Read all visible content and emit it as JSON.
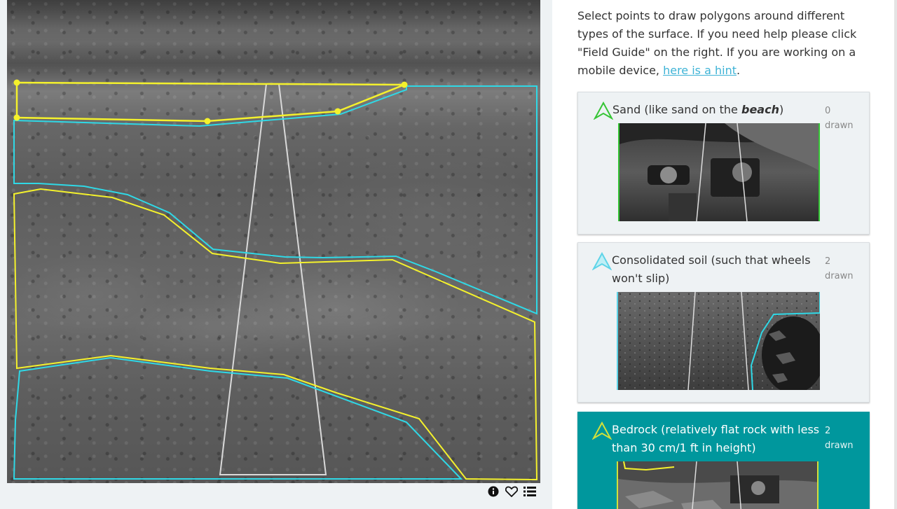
{
  "instructions": {
    "text": "Select points to draw polygons around different types of the surface. If you need help please click \"Field Guide\" on the right. If you are working on a mobile device,",
    "link_text": "here is a hint",
    "trailing": "."
  },
  "choices": [
    {
      "label_before": "Sand (like sand on the ",
      "label_emphasis": "beach",
      "label_after": ")",
      "count_number": "0",
      "count_word": "drawn",
      "color": "#35c535",
      "active": false
    },
    {
      "label": "Consolidated soil (such that wheels won't slip)",
      "count_number": "2",
      "count_word": "drawn",
      "color": "#5ed4e8",
      "active": false
    },
    {
      "label": "Bedrock (relatively flat rock with less than 30 cm/1 ft in height)",
      "count_number": "2",
      "count_word": "drawn",
      "color": "#d4e03a",
      "active": true
    }
  ],
  "toolbar": {
    "info_icon": "info-icon",
    "favorite_icon": "heart-icon",
    "collections_icon": "list-icon"
  },
  "colors": {
    "polygon_yellow": "#f4f12c",
    "polygon_cyan": "#2fd8e6",
    "rover_path": "#dddddd",
    "active_choice": "#00979d",
    "link": "#3eb3d6"
  }
}
